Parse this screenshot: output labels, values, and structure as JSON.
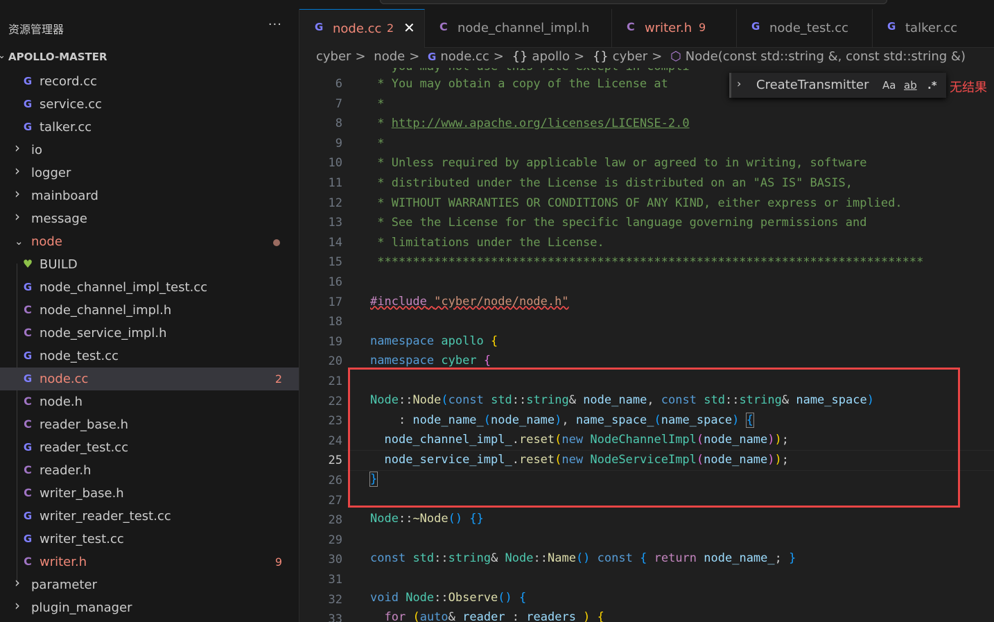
{
  "explorer": {
    "title": "资源管理器",
    "more": "···",
    "root": "APOLLO-MASTER",
    "items": [
      {
        "kind": "file",
        "icon": "cpp",
        "label": "record.cc"
      },
      {
        "kind": "file",
        "icon": "cpp",
        "label": "service.cc"
      },
      {
        "kind": "file",
        "icon": "cpp",
        "label": "talker.cc"
      },
      {
        "kind": "folder",
        "label": "io"
      },
      {
        "kind": "folder",
        "label": "logger"
      },
      {
        "kind": "folder",
        "label": "mainboard"
      },
      {
        "kind": "folder",
        "label": "message"
      },
      {
        "kind": "folder-open",
        "label": "node"
      },
      {
        "kind": "file",
        "icon": "build",
        "label": "BUILD"
      },
      {
        "kind": "file",
        "icon": "cpp",
        "label": "node_channel_impl_test.cc"
      },
      {
        "kind": "file",
        "icon": "c",
        "label": "node_channel_impl.h"
      },
      {
        "kind": "file",
        "icon": "c",
        "label": "node_service_impl.h"
      },
      {
        "kind": "file",
        "icon": "cpp",
        "label": "node_test.cc"
      },
      {
        "kind": "file",
        "icon": "cpp",
        "label": "node.cc",
        "badge": "2"
      },
      {
        "kind": "file",
        "icon": "c",
        "label": "node.h"
      },
      {
        "kind": "file",
        "icon": "c",
        "label": "reader_base.h"
      },
      {
        "kind": "file",
        "icon": "cpp",
        "label": "reader_test.cc"
      },
      {
        "kind": "file",
        "icon": "c",
        "label": "reader.h"
      },
      {
        "kind": "file",
        "icon": "c",
        "label": "writer_base.h"
      },
      {
        "kind": "file",
        "icon": "cpp",
        "label": "writer_reader_test.cc"
      },
      {
        "kind": "file",
        "icon": "cpp",
        "label": "writer_test.cc"
      },
      {
        "kind": "file",
        "icon": "c",
        "label": "writer.h",
        "badge": "9"
      },
      {
        "kind": "folder",
        "label": "parameter"
      },
      {
        "kind": "folder",
        "label": "plugin_manager"
      }
    ]
  },
  "tabs": [
    {
      "icon": "cpp",
      "label": "node.cc",
      "badge": "2",
      "close": "✕"
    },
    {
      "icon": "c",
      "label": "node_channel_impl.h"
    },
    {
      "icon": "c",
      "label": "writer.h",
      "badge": "9"
    },
    {
      "icon": "cpp",
      "label": "node_test.cc"
    },
    {
      "icon": "cpp",
      "label": "talker.cc"
    }
  ],
  "breadcrumb": {
    "cyber": "cyber",
    "node": "node",
    "file": "node.cc",
    "ns1": "apollo",
    "ns2": "cyber",
    "symbol": "Node(const std::string &, const std::string &)",
    "sep": ">",
    "braces": "{}"
  },
  "find": {
    "query": "CreateTransmitter",
    "case": "Aa",
    "word": "ab",
    "regex": ".*",
    "no_results": "无结果"
  },
  "editor": {
    "partial_line": " * you may not use this file except in compli",
    "line_numbers": [
      "6",
      "7",
      "8",
      "9",
      "10",
      "11",
      "12",
      "13",
      "14",
      "15",
      "16",
      "17",
      "18",
      "19",
      "20",
      "21",
      "22",
      "23",
      "24",
      "25",
      "26",
      "27",
      "28",
      "29",
      "30",
      "31",
      "32",
      "33"
    ],
    "current_line": "25",
    "comment_lines": [
      " * You may obtain a copy of the License at",
      " *",
      " * ",
      " *",
      " * Unless required by applicable law or agreed to in writing, software",
      " * distributed under the License is distributed on an \"AS IS\" BASIS,",
      " * WITHOUT WARRANTIES OR CONDITIONS OF ANY KIND, either express or implied.",
      " * See the License for the specific language governing permissions and",
      " * limitations under the License.",
      " *****************************************************************************"
    ],
    "license_url": "http://www.apache.org/licenses/LICENSE-2.0",
    "include_kw": "#include",
    "include_path": "\"cyber/node/node.h\"",
    "ns_kw": "namespace",
    "ns_apollo": "apollo",
    "ns_cyber": "cyber"
  }
}
